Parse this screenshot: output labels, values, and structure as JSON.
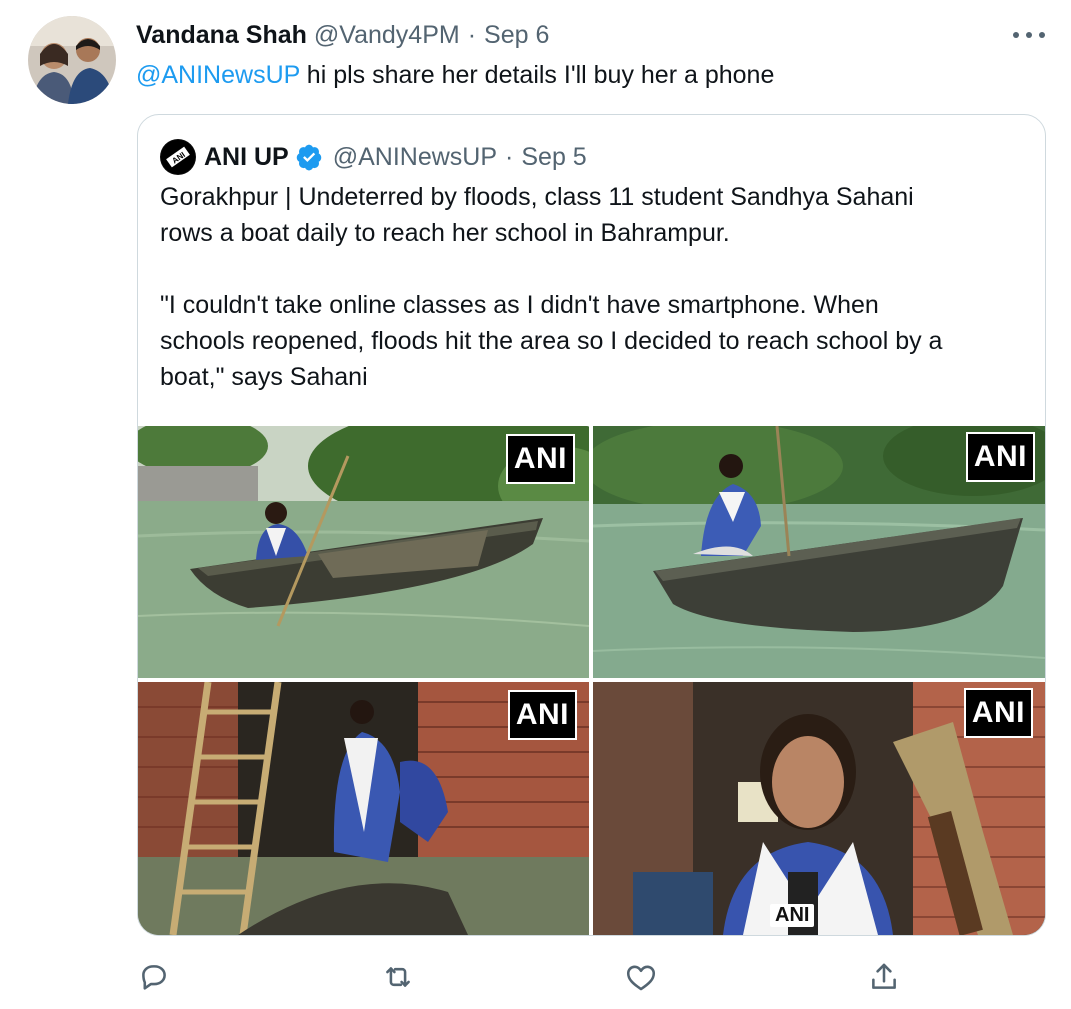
{
  "tweet": {
    "author_name": "Vandana Shah",
    "author_handle": "@Vandy4PM",
    "separator": "·",
    "date": "Sep 6",
    "mention": "@ANINewsUP",
    "text": "hi pls share her details I'll buy her a phone",
    "more_icon": "more-horizontal-icon"
  },
  "quoted": {
    "author_name": "ANI UP",
    "verified_icon": "verified-badge-icon",
    "author_handle": "@ANINewsUP",
    "separator": "·",
    "date": "Sep 5",
    "paragraph_1_line_1": "Gorakhpur | Undeterred by floods, class 11 student Sandhya Sahani",
    "paragraph_1_line_2": "rows a boat daily to reach her school in Bahrampur.",
    "paragraph_2_line_1": "\"I couldn't take online classes as I didn't have smartphone. When",
    "paragraph_2_line_2": "schools reopened, floods hit the area so I decided to reach school by a",
    "paragraph_2_line_3": "boat,\" says Sahani",
    "photos": [
      {
        "watermark": "ANI"
      },
      {
        "watermark": "ANI"
      },
      {
        "watermark": "ANI"
      },
      {
        "watermark": "ANI",
        "mic_label": "ANI"
      }
    ]
  },
  "actions": {
    "reply_icon": "reply-icon",
    "retweet_icon": "retweet-icon",
    "like_icon": "heart-icon",
    "share_icon": "share-icon"
  },
  "colors": {
    "link": "#1d9bf0",
    "secondary_text": "#536471",
    "border": "#cfd9de",
    "verified": "#1d9bf0"
  }
}
